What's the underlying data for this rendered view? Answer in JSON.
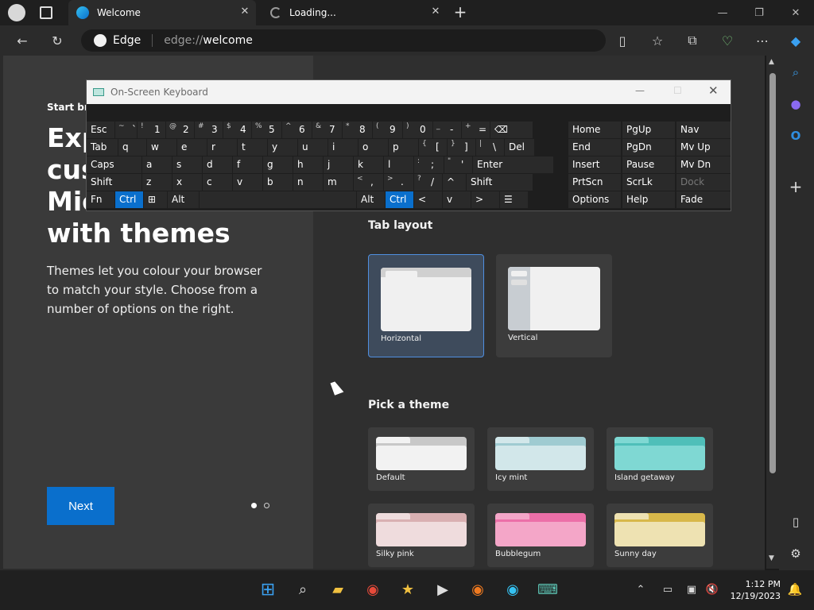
{
  "browser": {
    "tabs": [
      {
        "title": "Welcome",
        "close": "✕"
      },
      {
        "title": "Loading...",
        "close": "✕"
      }
    ],
    "new_tab": "+",
    "window_controls": [
      "—",
      "❐",
      "✕"
    ],
    "toolbar": {
      "brand": "Edge",
      "url_scheme": "edge://",
      "url_path": "welcome"
    }
  },
  "welcome": {
    "overline": "Start br",
    "heading_lines": [
      "Exp",
      "cust",
      "Micr",
      "with themes"
    ],
    "paragraph": "Themes let you colour your browser to match your style. Choose from a number of options on the right.",
    "next_label": "Next",
    "tab_layout_heading": "Tab layout",
    "tab_layouts": [
      "Horizontal",
      "Vertical"
    ],
    "themes_heading": "Pick a theme",
    "themes": [
      {
        "name": "Default",
        "colors": [
          "#c8c8c8",
          "#f2f2f2"
        ]
      },
      {
        "name": "Icy mint",
        "colors": [
          "#9fcbd1",
          "#d2e7ea"
        ]
      },
      {
        "name": "Island getaway",
        "colors": [
          "#4fbfb9",
          "#7fd8d3"
        ]
      },
      {
        "name": "Silky pink",
        "colors": [
          "#d9b0b2",
          "#efdcdd"
        ]
      },
      {
        "name": "Bubblegum",
        "colors": [
          "#ec6fa8",
          "#f4a6c8"
        ]
      },
      {
        "name": "Sunny day",
        "colors": [
          "#d8b84a",
          "#eee2b2"
        ]
      }
    ]
  },
  "osk": {
    "title": "On-Screen Keyboard",
    "rows": [
      [
        {
          "label": "Esc"
        },
        {
          "label": "`",
          "sub": "~"
        },
        {
          "label": "1",
          "sub": "!"
        },
        {
          "label": "2",
          "sub": "@"
        },
        {
          "label": "3",
          "sub": "#"
        },
        {
          "label": "4",
          "sub": "$"
        },
        {
          "label": "5",
          "sub": "%"
        },
        {
          "label": "6",
          "sub": "^"
        },
        {
          "label": "7",
          "sub": "&"
        },
        {
          "label": "8",
          "sub": "*"
        },
        {
          "label": "9",
          "sub": "("
        },
        {
          "label": "0",
          "sub": ")"
        },
        {
          "label": "-",
          "sub": "_"
        },
        {
          "label": "=",
          "sub": "+"
        },
        {
          "label": "⌫"
        }
      ],
      [
        {
          "label": "Tab"
        },
        {
          "label": "q"
        },
        {
          "label": "w"
        },
        {
          "label": "e"
        },
        {
          "label": "r"
        },
        {
          "label": "t"
        },
        {
          "label": "y"
        },
        {
          "label": "u"
        },
        {
          "label": "i"
        },
        {
          "label": "o"
        },
        {
          "label": "p"
        },
        {
          "label": "[",
          "sub": "{"
        },
        {
          "label": "]",
          "sub": "}"
        },
        {
          "label": "\\",
          "sub": "|"
        },
        {
          "label": "Del"
        }
      ],
      [
        {
          "label": "Caps"
        },
        {
          "label": "a"
        },
        {
          "label": "s"
        },
        {
          "label": "d"
        },
        {
          "label": "f"
        },
        {
          "label": "g"
        },
        {
          "label": "h"
        },
        {
          "label": "j"
        },
        {
          "label": "k"
        },
        {
          "label": "l"
        },
        {
          "label": ";",
          "sub": ":"
        },
        {
          "label": "'",
          "sub": "\""
        },
        {
          "label": "Enter"
        }
      ],
      [
        {
          "label": "Shift"
        },
        {
          "label": "z"
        },
        {
          "label": "x"
        },
        {
          "label": "c"
        },
        {
          "label": "v"
        },
        {
          "label": "b"
        },
        {
          "label": "n"
        },
        {
          "label": "m"
        },
        {
          "label": ",",
          "sub": "<"
        },
        {
          "label": ".",
          "sub": ">"
        },
        {
          "label": "/",
          "sub": "?"
        },
        {
          "label": "^"
        },
        {
          "label": "Shift"
        }
      ],
      [
        {
          "label": "Fn"
        },
        {
          "label": "Ctrl"
        },
        {
          "label": "⊞"
        },
        {
          "label": "Alt"
        },
        {
          "label": ""
        },
        {
          "label": "Alt"
        },
        {
          "label": "Ctrl"
        },
        {
          "label": "<"
        },
        {
          "label": "v"
        },
        {
          "label": ">"
        },
        {
          "label": "☰"
        }
      ]
    ],
    "nav_keys": [
      [
        "Home",
        "PgUp",
        "Nav"
      ],
      [
        "End",
        "PgDn",
        "Mv Up"
      ],
      [
        "Insert",
        "Pause",
        "Mv Dn"
      ],
      [
        "PrtScn",
        "ScrLk",
        "Dock"
      ],
      [
        "Options",
        "Help",
        "Fade"
      ]
    ]
  },
  "taskbar": {
    "time": "1:12 PM",
    "date": "12/19/2023"
  }
}
